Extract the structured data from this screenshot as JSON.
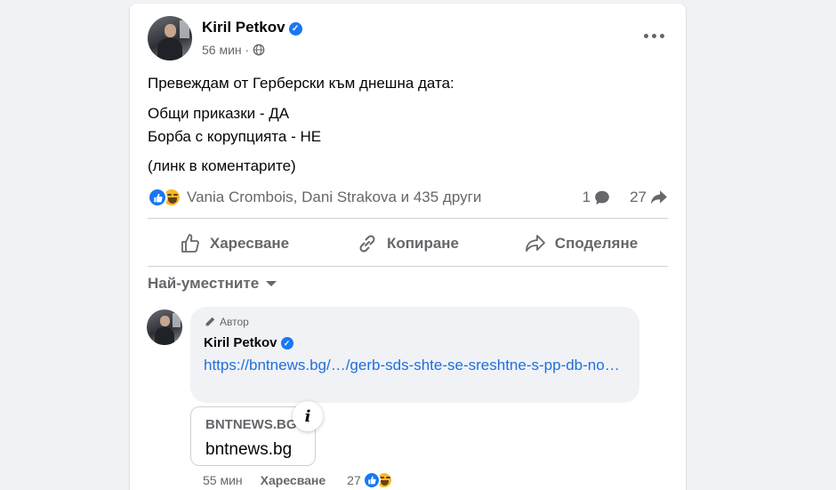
{
  "post": {
    "author": "Kiril Petkov",
    "time": "56 мин ·",
    "text_line1": "Превеждам от Герберски към днешна дата:",
    "text_line2": "Общи приказки - ДА",
    "text_line3": "Борба с корупцията - НЕ",
    "text_line4": "(линк в коментарите)",
    "reactors": "Vania Crombois, Dani Strakova и 435 други",
    "comment_count": "1",
    "share_count": "27"
  },
  "actions": {
    "like": "Харесване",
    "copy": "Копиране",
    "share": "Споделяне"
  },
  "comments": {
    "sort_label": "Най-уместните",
    "badge": "Автор",
    "author": "Kiril Petkov",
    "link_text": "https://bntnews.bg/…/gerb-sds-shte-se-sreshtne-s-pp-db-no…",
    "preview_domain": "BNTNEWS.BG",
    "preview_title": "bntnews.bg",
    "info_glyph": "i",
    "time": "55 мин",
    "like_label": "Харесване",
    "reaction_count": "27"
  },
  "colors": {
    "background": "#f0f2f5",
    "card": "#ffffff",
    "accent": "#1877f2",
    "link": "#216fdb",
    "secondary_text": "#65676b",
    "haha": "#f7b928"
  },
  "icons": [
    "verified-badge-icon",
    "globe-icon",
    "more-icon",
    "like-reaction-icon",
    "haha-reaction-icon",
    "comment-icon",
    "share-arrow-icon",
    "thumbs-up-icon",
    "link-copy-icon",
    "share-icon",
    "caret-down-icon",
    "pencil-icon",
    "info-icon"
  ]
}
